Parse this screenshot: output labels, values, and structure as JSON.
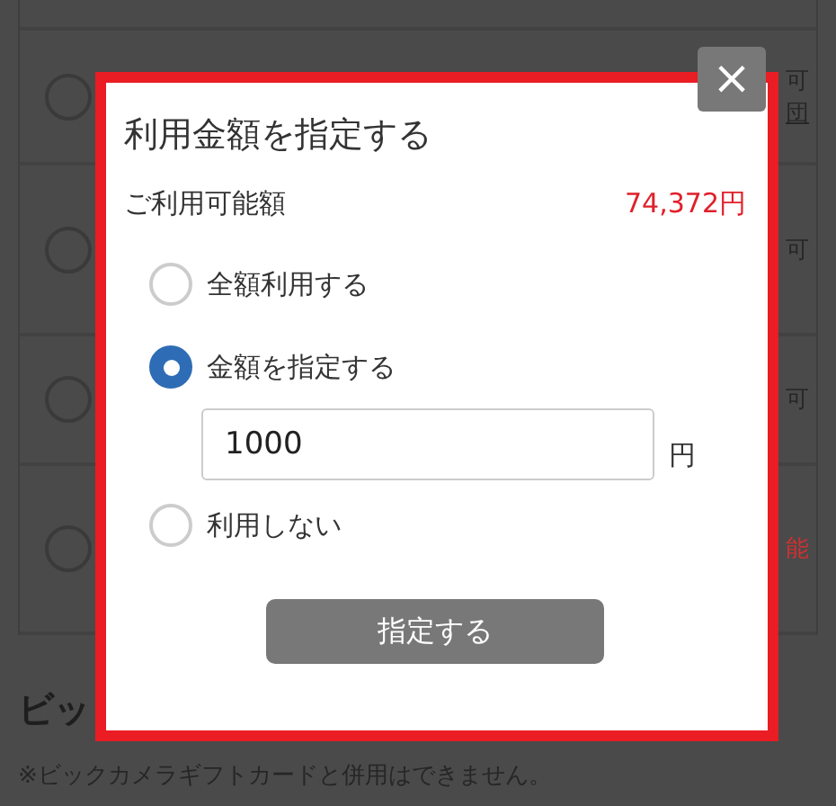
{
  "page": {
    "rows": [
      {},
      {
        "status": "可",
        "link": "団",
        "selected": false
      },
      {
        "status": "可",
        "selected": false
      },
      {
        "status": "可",
        "selected": false
      },
      {
        "status": "能",
        "selected": false
      }
    ],
    "heading": "ビッ",
    "note": "※ビックカメラギフトカードと併用はできません。"
  },
  "modal": {
    "close": "×",
    "title": "利用金額を指定する",
    "available_label": "ご利用可能額",
    "available_amount": "74,372円",
    "options": [
      {
        "label": "全額利用する",
        "selected": false
      },
      {
        "label": "金額を指定する",
        "selected": true,
        "kind": "amount",
        "value": "1000",
        "unit": "円"
      },
      {
        "label": "利用しない",
        "selected": false
      }
    ],
    "submit": "指定する"
  }
}
